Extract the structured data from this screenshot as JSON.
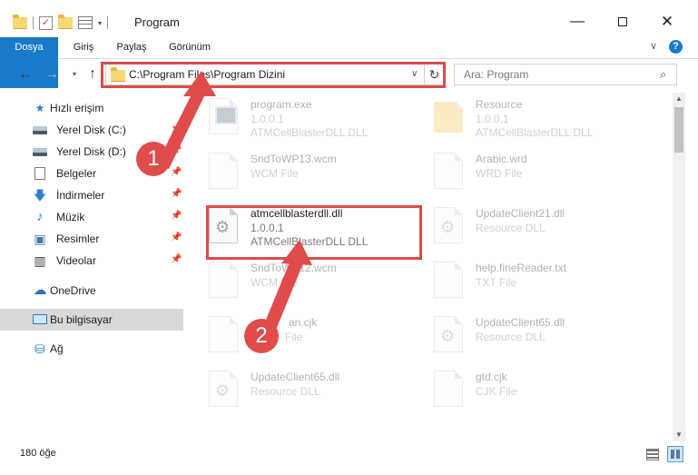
{
  "window": {
    "title": "Program",
    "minimize_glyph": "—",
    "close_glyph": "✕"
  },
  "quick_access": {
    "check_glyph": "✓",
    "caret_glyph": "▾"
  },
  "ribbon": {
    "tabs": [
      "Dosya",
      "Giriş",
      "Paylaş",
      "Görünüm"
    ],
    "expand_glyph": "∨",
    "help_glyph": "?"
  },
  "address_bar": {
    "back_glyph": "←",
    "forward_glyph": "→",
    "recent_glyph": "▾",
    "up_glyph": "↑",
    "path": "C:\\Program Files\\Program Dizini",
    "dropdown_glyph": "∨",
    "refresh_glyph": "↻",
    "search_placeholder": "Ara: Program",
    "search_glyph": "⌕"
  },
  "sidebar": {
    "pin_glyph": "📌",
    "items": [
      {
        "label": "Hızlı erişim",
        "icon": "star-icon",
        "glyph": "★"
      },
      {
        "label": "Yerel Disk (C:)",
        "icon": "drive-icon",
        "glyph": ""
      },
      {
        "label": "Yerel Disk (D:)",
        "icon": "drive-icon",
        "glyph": ""
      },
      {
        "label": "Belgeler",
        "icon": "document-icon",
        "glyph": ""
      },
      {
        "label": "İndirmeler",
        "icon": "download-icon",
        "glyph": "🡇"
      },
      {
        "label": "Müzik",
        "icon": "music-icon",
        "glyph": "♪"
      },
      {
        "label": "Resimler",
        "icon": "picture-icon",
        "glyph": "▣"
      },
      {
        "label": "Videolar",
        "icon": "film-icon",
        "glyph": "▥"
      },
      {
        "label": "OneDrive",
        "icon": "cloud-icon",
        "glyph": "☁"
      },
      {
        "label": "Bu bilgisayar",
        "icon": "computer-icon",
        "glyph": ""
      },
      {
        "label": "Ağ",
        "icon": "network-icon",
        "glyph": "⛁"
      }
    ]
  },
  "files": [
    {
      "name": "program.exe",
      "line2": "1.0.0.1",
      "line3": "ATMCellBlasterDLL DLL"
    },
    {
      "name": "Resource",
      "line2": "1.0.0.1",
      "line3": "ATMCellBlasterDLL DLL"
    },
    {
      "name": "SndToWP13.wcm",
      "line2": "WCM File",
      "line3": ""
    },
    {
      "name": "Arabic.wrd",
      "line2": "WRD File",
      "line3": ""
    },
    {
      "name": "atmcellblasterdll.dll",
      "line2": "1.0.0.1",
      "line3": "ATMCellBlasterDLL DLL"
    },
    {
      "name": "UpdateClient21.dll",
      "line2": "Resource DLL",
      "line3": ""
    },
    {
      "name": "SndToWP12.wcm",
      "line2": "WCM File",
      "line3": ""
    },
    {
      "name": "help.fineReader.txt",
      "line2": "TXT File",
      "line3": ""
    },
    {
      "name": "an.cjk",
      "line2": "File",
      "line3": ""
    },
    {
      "name": "UpdateClient65.dll",
      "line2": "Resource DLL",
      "line3": ""
    },
    {
      "name": "UpdateClient65.dll",
      "line2": "Resource DLL",
      "line3": ""
    },
    {
      "name": "gtd.cjk",
      "line2": "CJK File",
      "line3": ""
    }
  ],
  "scrollbar": {
    "up_glyph": "▲",
    "down_glyph": "▼"
  },
  "status_bar": {
    "item_count": "180 öğe"
  },
  "annotations": {
    "step1": "1",
    "step2": "2",
    "color": "#e04b4b"
  }
}
